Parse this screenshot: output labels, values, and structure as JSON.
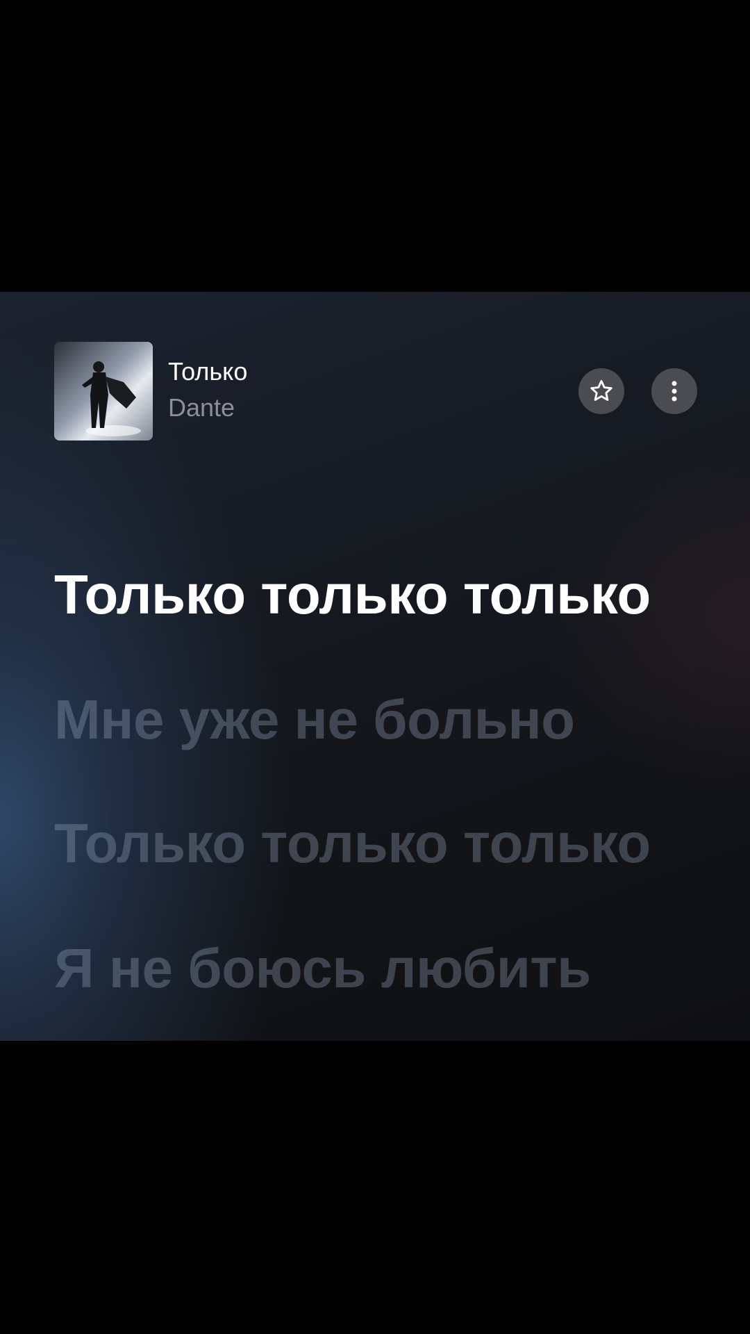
{
  "track": {
    "title": "Только",
    "artist": "Dante",
    "cover_icon": "album-cover"
  },
  "actions": {
    "favorite_icon": "star-icon",
    "more_icon": "more-vertical-icon"
  },
  "lyrics": {
    "active_line": "Только только только",
    "upcoming": [
      "Мне уже не больно",
      "Только только только",
      "Я не боюсь любить"
    ]
  },
  "colors": {
    "active_text": "#ffffff",
    "dim_text": "#5b6472",
    "artist_text": "#8c8f96",
    "button_bg": "#4a4c52"
  }
}
